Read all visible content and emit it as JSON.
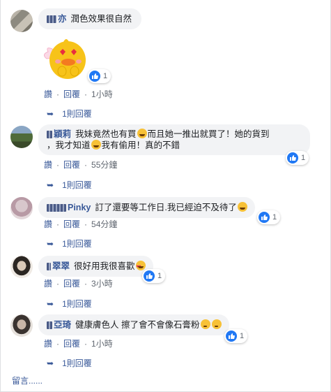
{
  "colors": {
    "link": "#385898",
    "meta": "#606770",
    "bubble": "#f2f3f5",
    "like": "#2078f4"
  },
  "actions": {
    "like": "讚",
    "reply": "回覆",
    "sep": "·"
  },
  "comments": [
    {
      "name": "亦",
      "text": "潤色效果很自然",
      "time": "1小時",
      "reactions": "1",
      "replies": "1則回覆",
      "sticker": "heart-eyes-chick-sticker"
    },
    {
      "name": "穎莉",
      "text_a": "我妹竟然也有買",
      "text_b": "而且她一推出就買了！她的貨到",
      "text_c": "，我才知道",
      "text_d": "我有偷用！真的不錯",
      "time": "55分鐘",
      "reactions": "1",
      "replies": "1則回覆"
    },
    {
      "name": "Pinky",
      "text": "訂了還要等工作日.我已經迫不及待了",
      "time": "54分鐘",
      "reactions": "1",
      "replies": "1則回覆"
    },
    {
      "name": "翠翠",
      "text": "很好用我很喜歡",
      "time": "3小時",
      "reactions": "1",
      "replies": "1則回覆"
    },
    {
      "name": "亞琦",
      "text": "健康膚色人 擦了會不會像石膏粉",
      "time": "1小時",
      "reactions": "1",
      "replies": "1則回覆"
    }
  ],
  "footer": "留言......"
}
